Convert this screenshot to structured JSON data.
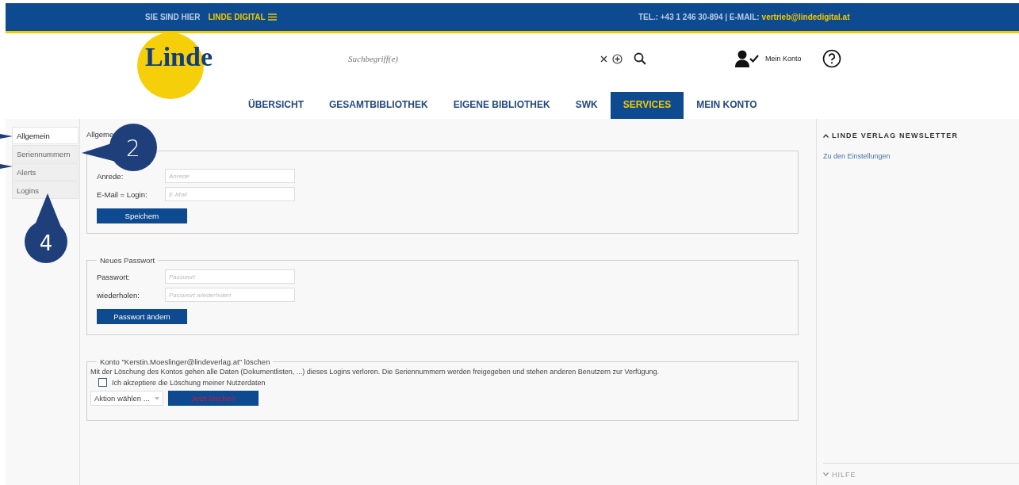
{
  "top_bar": {
    "location_label": "SIE SIND HIER",
    "site_menu": "LINDE DIGITAL",
    "contact_prefix": "TEL.: +43 1 246 30-894  |  E-MAIL:",
    "contact_email": "vertrieb@lindedigital.at"
  },
  "header": {
    "logo": "Linde",
    "search": {
      "placeholder": "Suchbegriff(e)"
    },
    "account_label": "Mein Konto"
  },
  "nav": [
    {
      "label": "ÜBERSICHT",
      "selected": false
    },
    {
      "label": "GESAMTBIBLIOTHEK",
      "selected": false
    },
    {
      "label": "EIGENE BIBLIOTHEK",
      "selected": false
    },
    {
      "label": "SWK",
      "selected": false
    },
    {
      "label": "SERVICES",
      "selected": true
    },
    {
      "label": "MEIN KONTO",
      "selected": false
    }
  ],
  "sidebar": {
    "items": [
      {
        "label": "Allgemein",
        "selected": true
      },
      {
        "label": "Seriennummern",
        "selected": false
      },
      {
        "label": "Alerts",
        "selected": false
      },
      {
        "label": "Logins",
        "selected": false
      }
    ]
  },
  "breadcrumb": "Allgeme",
  "user_section": {
    "fields": [
      {
        "label": "Anrede:",
        "placeholder": "Anrede"
      },
      {
        "label": "E-Mail = Login:",
        "placeholder": "E-Mail"
      }
    ],
    "button": "Speichern"
  },
  "password_section": {
    "legend": "Neues Passwort",
    "fields": [
      {
        "label": "Passwort:",
        "placeholder": "Passwort"
      },
      {
        "label": "wiederholen:",
        "placeholder": "Passwort wiederholen"
      }
    ],
    "button": "Passwort ändern"
  },
  "delete_section": {
    "legend": "Konto \"Kerstin.Moeslinger@lindeverlag.at\" löschen",
    "text": "Mit der Löschung des Kontos gehen alle Daten (Dokumentlisten, ...) dieses Logins verloren. Die Seriennummern werden freigegeben und stehen anderen Benutzern zur Verfügung.",
    "consent": {
      "label": "Ich akzeptiere die Löschung meiner Nutzerdaten",
      "checked": false
    },
    "action_select": "Aktion wählen ...",
    "button": "Jetzt löschen"
  },
  "right_panel": {
    "newsletter": {
      "title": "LINDE VERLAG NEWSLETTER",
      "expanded": true,
      "link": "Zu den Einstellungen"
    },
    "help": {
      "title": "HILFE",
      "expanded": false
    }
  },
  "annotations": [
    {
      "number": "2"
    },
    {
      "number": "4"
    }
  ]
}
